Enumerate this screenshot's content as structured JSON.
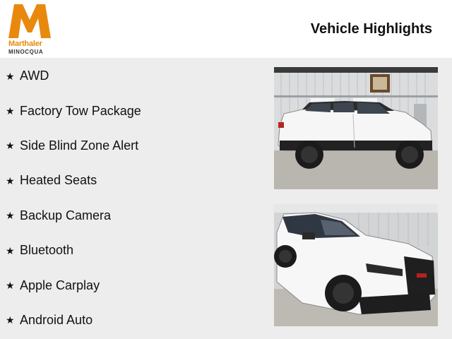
{
  "dealer": {
    "name": "Marthaler",
    "location": "MINOCQUA",
    "brand_color": "#e8890e"
  },
  "page": {
    "title": "Vehicle Highlights"
  },
  "features": [
    {
      "icon": "star-icon",
      "label": "AWD"
    },
    {
      "icon": "star-icon",
      "label": "Factory Tow Package"
    },
    {
      "icon": "star-icon",
      "label": "Side Blind Zone Alert"
    },
    {
      "icon": "star-icon",
      "label": "Heated Seats"
    },
    {
      "icon": "star-icon",
      "label": "Backup Camera"
    },
    {
      "icon": "star-icon",
      "label": "Bluetooth"
    },
    {
      "icon": "star-icon",
      "label": "Apple Carplay"
    },
    {
      "icon": "star-icon",
      "label": "Android Auto"
    }
  ],
  "photos": [
    {
      "subject": "white SUV side view in garage"
    },
    {
      "subject": "white SUV front three-quarter view in garage"
    }
  ]
}
